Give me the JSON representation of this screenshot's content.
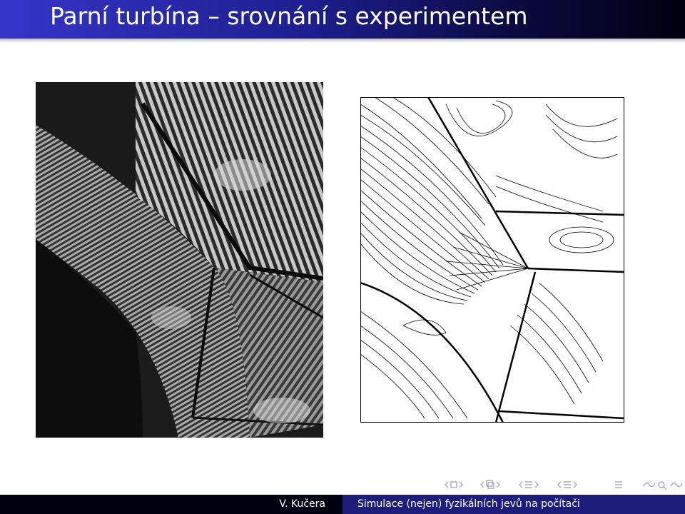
{
  "slide": {
    "title": "Parní turbína – srovnání s experimentem"
  },
  "figures": {
    "left": "interferogram-photo",
    "right": "isoline-simulation"
  },
  "footer": {
    "author": "V. Kučera",
    "talk": "Simulace (nejen) fyzikálních jevů na počítači"
  },
  "colors": {
    "title_bar_start": "#3535c8",
    "title_bar_end": "#000010",
    "footer_left": "#000010",
    "footer_right": "#1e1e7a",
    "nav_icons": "#9a9ab8"
  }
}
